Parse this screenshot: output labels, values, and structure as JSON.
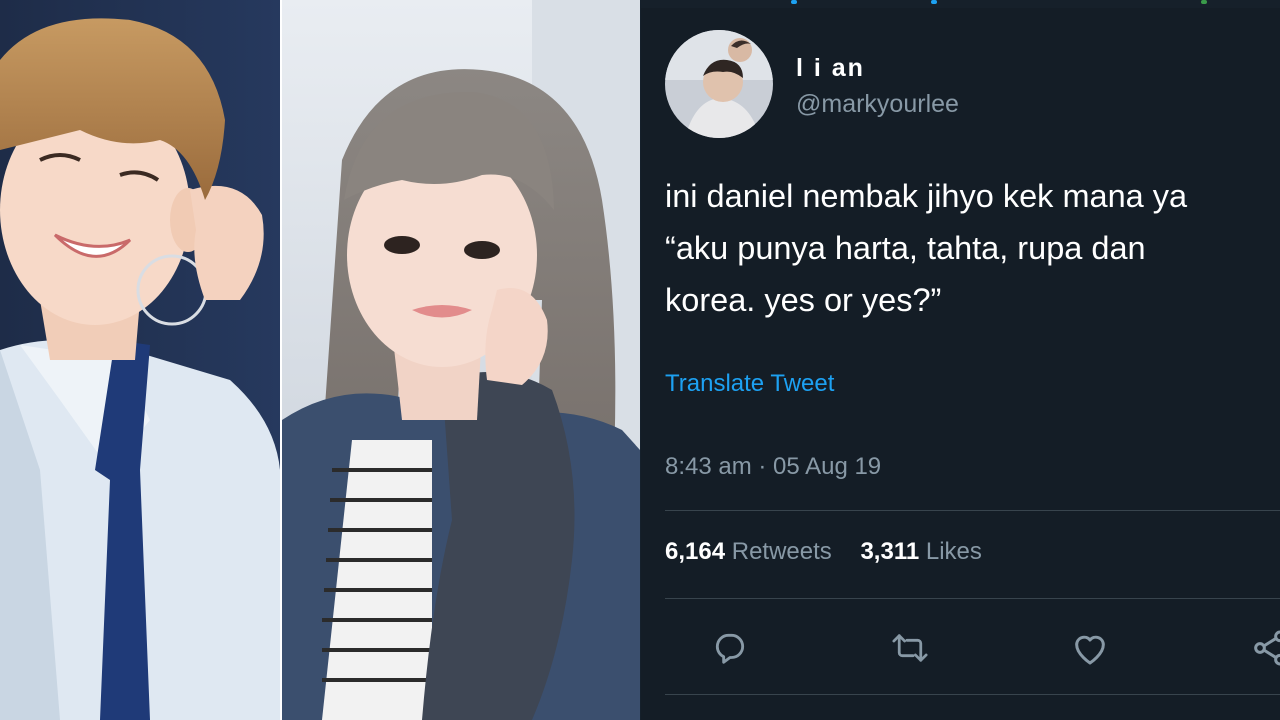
{
  "tweet": {
    "display_name": "l i an",
    "handle": "@markyourlee",
    "text_lines": [
      "ini daniel nembak jihyo kek mana ya",
      "“aku punya harta, tahta, rupa dan",
      "korea. yes or yes?”"
    ],
    "translate_label": "Translate Tweet",
    "timestamp": "8:43 am · 05 Aug 19",
    "retweets": {
      "count": "6,164",
      "label": "Retweets"
    },
    "likes": {
      "count": "3,311",
      "label": "Likes"
    },
    "actions": {
      "reply": {
        "icon": "reply-icon"
      },
      "retweet": {
        "icon": "retweet-icon"
      },
      "like": {
        "icon": "heart-icon"
      },
      "share": {
        "icon": "share-icon"
      }
    }
  },
  "colors": {
    "background": "#141d26",
    "text": "#ffffff",
    "secondary": "#8899a6",
    "link": "#1da1f2",
    "divider": "#38444d"
  }
}
